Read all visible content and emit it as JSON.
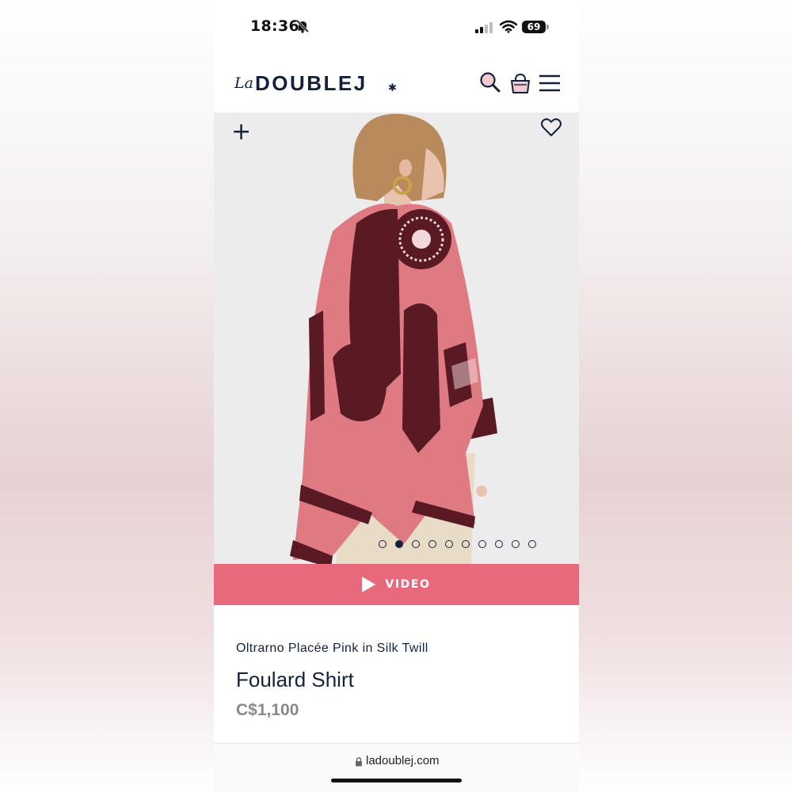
{
  "status_bar": {
    "time": "18:36",
    "battery": "69"
  },
  "brand": {
    "prefix": "La",
    "name": "DOUBLEJ",
    "mark": "✱"
  },
  "header": {
    "icons": [
      "search-icon",
      "bag-icon",
      "menu-icon"
    ]
  },
  "gallery": {
    "plus": "+",
    "image_count": 10,
    "active_index": 1
  },
  "video": {
    "label": "VIDEO"
  },
  "product": {
    "subtitle": "Oltrarno Placée Pink in Silk Twill",
    "title": "Foulard Shirt",
    "price": "C$1,100"
  },
  "browser": {
    "url": "ladoublej.com"
  },
  "colors": {
    "accent_pink": "#e66a7c",
    "navy": "#14213d",
    "burgundy": "#5a1a24",
    "rose": "#e07a82"
  }
}
